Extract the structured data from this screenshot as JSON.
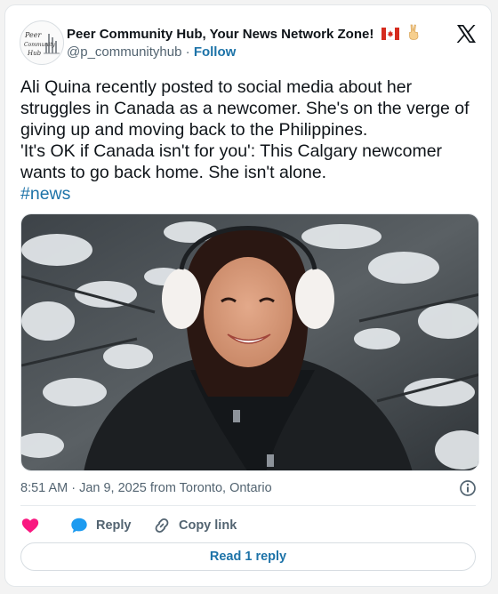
{
  "author": {
    "display_name": "Peer Community Hub, Your News Network Zone!",
    "emojis": [
      "canada-flag",
      "victory-hand"
    ],
    "handle": "@p_communityhub",
    "separator": "·",
    "follow_label": "Follow",
    "avatar_text": [
      "Peer",
      "Community",
      "Hub"
    ]
  },
  "post": {
    "paragraph_1": "Ali Quina recently posted to social media about her struggles in Canada as a newcomer. She's on the verge of giving up and moving back to the Philippines.",
    "paragraph_2": "'It's OK if Canada isn't for you': This Calgary newcomer wants to go back home. She isn't alone.",
    "hashtag": "#news"
  },
  "meta": {
    "timestamp": "8:51 AM · Jan 9, 2025 from Toronto, Ontario"
  },
  "actions": {
    "like_icon": "heart-icon",
    "reply_label": "Reply",
    "copy_link_label": "Copy link"
  },
  "read_replies_label": "Read 1 reply",
  "colors": {
    "link": "#1d73a8",
    "heart": "#f91880",
    "text": "#0f1419",
    "muted": "#536471"
  }
}
